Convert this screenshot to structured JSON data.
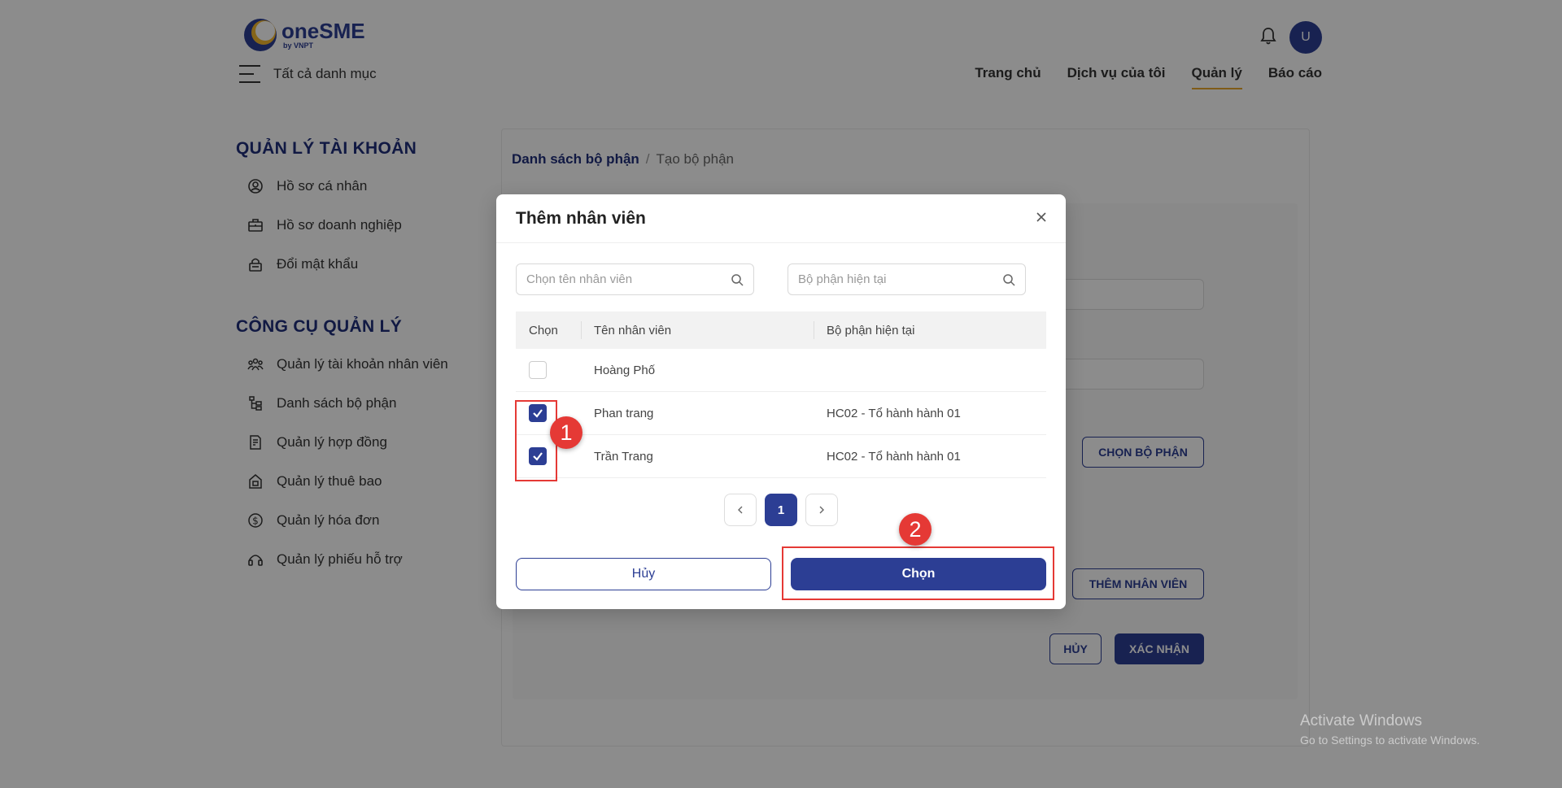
{
  "header": {
    "logo_name": "oneSME",
    "logo_sub": "by VNPT",
    "menu_label": "Tất cả danh mục",
    "avatar_initial": "U",
    "nav": [
      {
        "label": "Trang chủ",
        "active": false
      },
      {
        "label": "Dịch vụ của tôi",
        "active": false
      },
      {
        "label": "Quản lý",
        "active": true
      },
      {
        "label": "Báo cáo",
        "active": false
      }
    ]
  },
  "sidebar": {
    "section1_title": "QUẢN LÝ TÀI KHOẢN",
    "section1_items": [
      {
        "label": "Hồ sơ cá nhân",
        "icon": "user-circle-icon"
      },
      {
        "label": "Hồ sơ doanh nghiệp",
        "icon": "briefcase-icon"
      },
      {
        "label": "Đổi mật khẩu",
        "icon": "lock-icon"
      }
    ],
    "section2_title": "CÔNG CỤ QUẢN LÝ",
    "section2_items": [
      {
        "label": "Quản lý tài khoản nhân viên",
        "icon": "users-icon"
      },
      {
        "label": "Danh sách bộ phận",
        "icon": "org-tree-icon"
      },
      {
        "label": "Quản lý hợp đồng",
        "icon": "contract-icon"
      },
      {
        "label": "Quản lý thuê bao",
        "icon": "subscription-icon"
      },
      {
        "label": "Quản lý hóa đơn",
        "icon": "invoice-dollar-icon"
      },
      {
        "label": "Quản lý phiếu hỗ trợ",
        "icon": "headset-icon"
      }
    ]
  },
  "content": {
    "breadcrumb_parent": "Danh sách bộ phận",
    "breadcrumb_sep": "/",
    "breadcrumb_current": "Tạo bộ phận",
    "choose_dept_button": "CHỌN BỘ PHẬN",
    "add_employee_button": "THÊM NHÂN VIÊN",
    "cancel_button": "HỦY",
    "confirm_button": "XÁC NHẬN"
  },
  "modal": {
    "title": "Thêm nhân viên",
    "search_name_placeholder": "Chọn tên nhân viên",
    "search_dept_placeholder": "Bộ phận hiện tại",
    "columns": [
      "Chọn",
      "Tên nhân viên",
      "Bộ phận hiện tại"
    ],
    "rows": [
      {
        "checked": false,
        "name": "Hoàng Phố",
        "dept": ""
      },
      {
        "checked": true,
        "name": "Phan trang",
        "dept": "HC02 - Tổ hành hành 01"
      },
      {
        "checked": true,
        "name": "Trần Trang",
        "dept": "HC02 - Tổ hành hành 01"
      }
    ],
    "page_current": "1",
    "cancel_label": "Hủy",
    "ok_label": "Chọn"
  },
  "annotations": {
    "badge1": "1",
    "badge2": "2",
    "color": "#e53935"
  },
  "watermark": {
    "line1": "Activate Windows",
    "line2": "Go to Settings to activate Windows."
  },
  "colors": {
    "brand": "#2c3e94",
    "nav_underline": "#e7a72c"
  }
}
